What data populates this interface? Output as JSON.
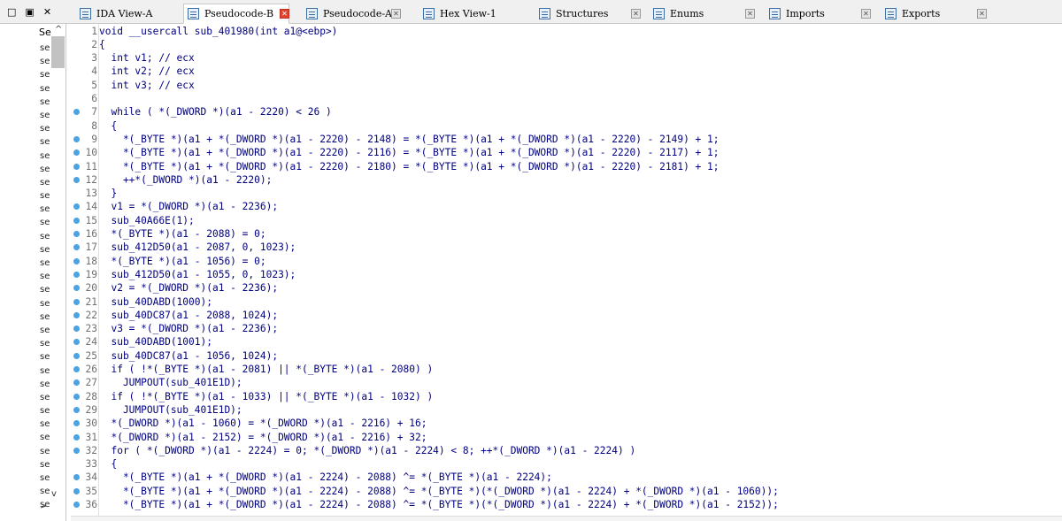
{
  "window_controls": [
    "□",
    "▣",
    "✕"
  ],
  "tabs": [
    {
      "label": "IDA View-A",
      "active": false
    },
    {
      "label": "Pseudocode-B",
      "active": true
    },
    {
      "label": "Pseudocode-A",
      "active": false
    },
    {
      "label": "Hex View-1",
      "active": false
    },
    {
      "label": "Structures",
      "active": false
    },
    {
      "label": "Enums",
      "active": false
    },
    {
      "label": "Imports",
      "active": false
    },
    {
      "label": "Exports",
      "active": false
    }
  ],
  "left_panel": {
    "header": "Se",
    "row_label": "se",
    "row_count": 35
  },
  "code_lines": [
    {
      "n": "1",
      "dot": false,
      "text": "void __usercall sub_401980(int a1@<ebp>)"
    },
    {
      "n": "2",
      "dot": false,
      "text": "{"
    },
    {
      "n": "3",
      "dot": false,
      "text": "  int v1; // ecx"
    },
    {
      "n": "4",
      "dot": false,
      "text": "  int v2; // ecx"
    },
    {
      "n": "5",
      "dot": false,
      "text": "  int v3; // ecx"
    },
    {
      "n": "6",
      "dot": false,
      "text": ""
    },
    {
      "n": "7",
      "dot": true,
      "text": "  while ( *(_DWORD *)(a1 - 2220) < 26 )"
    },
    {
      "n": "8",
      "dot": false,
      "text": "  {"
    },
    {
      "n": "9",
      "dot": true,
      "text": "    *(_BYTE *)(a1 + *(_DWORD *)(a1 - 2220) - 2148) = *(_BYTE *)(a1 + *(_DWORD *)(a1 - 2220) - 2149) + 1;"
    },
    {
      "n": "10",
      "dot": true,
      "text": "    *(_BYTE *)(a1 + *(_DWORD *)(a1 - 2220) - 2116) = *(_BYTE *)(a1 + *(_DWORD *)(a1 - 2220) - 2117) + 1;"
    },
    {
      "n": "11",
      "dot": true,
      "text": "    *(_BYTE *)(a1 + *(_DWORD *)(a1 - 2220) - 2180) = *(_BYTE *)(a1 + *(_DWORD *)(a1 - 2220) - 2181) + 1;"
    },
    {
      "n": "12",
      "dot": true,
      "text": "    ++*(_DWORD *)(a1 - 2220);"
    },
    {
      "n": "13",
      "dot": false,
      "text": "  }"
    },
    {
      "n": "14",
      "dot": true,
      "text": "  v1 = *(_DWORD *)(a1 - 2236);"
    },
    {
      "n": "15",
      "dot": true,
      "text": "  sub_40A66E(1);"
    },
    {
      "n": "16",
      "dot": true,
      "text": "  *(_BYTE *)(a1 - 2088) = 0;"
    },
    {
      "n": "17",
      "dot": true,
      "text": "  sub_412D50(a1 - 2087, 0, 1023);"
    },
    {
      "n": "18",
      "dot": true,
      "text": "  *(_BYTE *)(a1 - 1056) = 0;"
    },
    {
      "n": "19",
      "dot": true,
      "text": "  sub_412D50(a1 - 1055, 0, 1023);"
    },
    {
      "n": "20",
      "dot": true,
      "text": "  v2 = *(_DWORD *)(a1 - 2236);"
    },
    {
      "n": "21",
      "dot": true,
      "text": "  sub_40DABD(1000);"
    },
    {
      "n": "22",
      "dot": true,
      "text": "  sub_40DC87(a1 - 2088, 1024);"
    },
    {
      "n": "23",
      "dot": true,
      "text": "  v3 = *(_DWORD *)(a1 - 2236);"
    },
    {
      "n": "24",
      "dot": true,
      "text": "  sub_40DABD(1001);"
    },
    {
      "n": "25",
      "dot": true,
      "text": "  sub_40DC87(a1 - 1056, 1024);"
    },
    {
      "n": "26",
      "dot": true,
      "text": "  if ( !*(_BYTE *)(a1 - 2081) || *(_BYTE *)(a1 - 2080) )"
    },
    {
      "n": "27",
      "dot": true,
      "text": "    JUMPOUT(sub_401E1D);"
    },
    {
      "n": "28",
      "dot": true,
      "text": "  if ( !*(_BYTE *)(a1 - 1033) || *(_BYTE *)(a1 - 1032) )"
    },
    {
      "n": "29",
      "dot": true,
      "text": "    JUMPOUT(sub_401E1D);"
    },
    {
      "n": "30",
      "dot": true,
      "text": "  *(_DWORD *)(a1 - 1060) = *(_DWORD *)(a1 - 2216) + 16;"
    },
    {
      "n": "31",
      "dot": true,
      "text": "  *(_DWORD *)(a1 - 2152) = *(_DWORD *)(a1 - 2216) + 32;"
    },
    {
      "n": "32",
      "dot": true,
      "text": "  for ( *(_DWORD *)(a1 - 2224) = 0; *(_DWORD *)(a1 - 2224) < 8; ++*(_DWORD *)(a1 - 2224) )"
    },
    {
      "n": "33",
      "dot": false,
      "text": "  {"
    },
    {
      "n": "34",
      "dot": true,
      "text": "    *(_BYTE *)(a1 + *(_DWORD *)(a1 - 2224) - 2088) ^= *(_BYTE *)(a1 - 2224);"
    },
    {
      "n": "35",
      "dot": true,
      "text": "    *(_BYTE *)(a1 + *(_DWORD *)(a1 - 2224) - 2088) ^= *(_BYTE *)(*(_DWORD *)(a1 - 2224) + *(_DWORD *)(a1 - 1060));"
    },
    {
      "n": "36",
      "dot": true,
      "text": "    *(_BYTE *)(a1 + *(_DWORD *)(a1 - 2224) - 2088) ^= *(_BYTE *)(*(_DWORD *)(a1 - 2224) + *(_DWORD *)(a1 - 2152));"
    }
  ],
  "colors": {
    "code_text": "#000080",
    "line_number": "#707070",
    "breakpoint_dot": "#4aa3e2",
    "active_tab_close": "#e0442f"
  }
}
